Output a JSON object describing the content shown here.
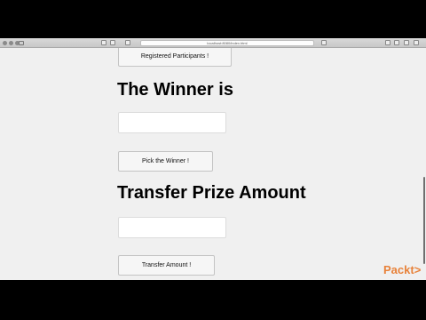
{
  "browser": {
    "url": "localhost:8080/index.html"
  },
  "page": {
    "registered_button": "Registered Participants !",
    "winner_heading": "The Winner is",
    "winner_input_value": "",
    "pick_winner_button": "Pick the Winner !",
    "transfer_heading": "Transfer Prize Amount",
    "transfer_input_value": "",
    "transfer_button": "Transfer Amount !"
  },
  "watermark": {
    "logo_text": "Packt>"
  },
  "colors": {
    "page_background": "#f0f0f0",
    "logo_accent": "#e8823a"
  }
}
